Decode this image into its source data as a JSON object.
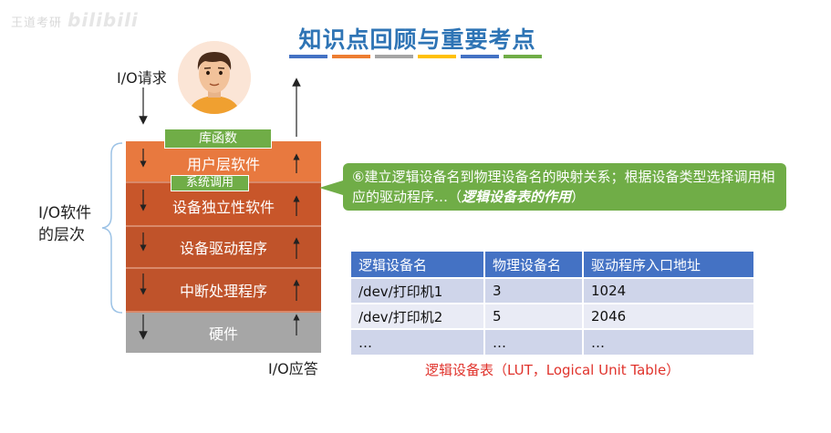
{
  "watermark": {
    "text": "王道考研",
    "logo": "bilibili"
  },
  "title": "知识点回顾与重要考点",
  "title_bar_colors": [
    "#4472c4",
    "#ed7d31",
    "#a5a5a5",
    "#ffc000",
    "#4472c4",
    "#70ad47"
  ],
  "diagram": {
    "io_request": "I/O请求",
    "io_response": "I/O应答",
    "hierarchy_label_line1": "I/O软件",
    "hierarchy_label_line2": "的层次",
    "lib_func_tag": "库函数",
    "syscall_tag": "系统调用",
    "layers": [
      "用户层软件",
      "设备独立性软件",
      "设备驱动程序",
      "中断处理程序",
      "硬件"
    ]
  },
  "callout": {
    "text": "⑥建立逻辑设备名到物理设备名的映射关系；根据设备类型选择调用相应的驱动程序…（",
    "emphasis": "逻辑设备表的作用",
    "end": "）"
  },
  "lut": {
    "headers": [
      "逻辑设备名",
      "物理设备名",
      "驱动程序入口地址"
    ],
    "rows": [
      [
        "/dev/打印机1",
        "3",
        "1024"
      ],
      [
        "/dev/打印机2",
        "5",
        "2046"
      ],
      [
        "…",
        "…",
        "…"
      ]
    ],
    "caption": "逻辑设备表（LUT，Logical Unit Table）"
  }
}
